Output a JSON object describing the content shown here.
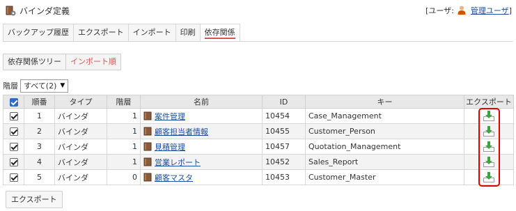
{
  "header": {
    "title": "バインダ定義",
    "user_prefix": "[ユーザ:",
    "user_name": "管理ユーザ",
    "user_suffix": "]"
  },
  "tabs": [
    {
      "label": "バックアップ履歴"
    },
    {
      "label": "エクスポート"
    },
    {
      "label": "インポート"
    },
    {
      "label": "印刷"
    },
    {
      "label": "依存関係",
      "active": true
    }
  ],
  "subtabs": [
    {
      "label": "依存関係ツリー"
    },
    {
      "label": "インポート順",
      "active": true
    }
  ],
  "level_filter": {
    "label": "階層",
    "selected": "すべて(2)"
  },
  "table": {
    "columns": [
      "",
      "順番",
      "タイプ",
      "階層",
      "名前",
      "ID",
      "キー",
      "エクスポート"
    ],
    "rows": [
      {
        "order": "1",
        "type": "バインダ",
        "level": "1",
        "name": "案件管理",
        "id": "10454",
        "key": "Case_Management"
      },
      {
        "order": "2",
        "type": "バインダ",
        "level": "1",
        "name": "顧客担当者情報",
        "id": "10455",
        "key": "Customer_Person"
      },
      {
        "order": "3",
        "type": "バインダ",
        "level": "1",
        "name": "見積管理",
        "id": "10457",
        "key": "Quotation_Management"
      },
      {
        "order": "4",
        "type": "バインダ",
        "level": "1",
        "name": "営業レポート",
        "id": "10452",
        "key": "Sales_Report"
      },
      {
        "order": "5",
        "type": "バインダ",
        "level": "0",
        "name": "顧客マスタ",
        "id": "10453",
        "key": "Customer_Master"
      }
    ]
  },
  "footer": {
    "export_button": "エクスポート"
  },
  "colors": {
    "accent": "#d9534f",
    "link": "#1a4fa3",
    "highlight": "#e00000",
    "header_bg": "#e8e8e8"
  }
}
